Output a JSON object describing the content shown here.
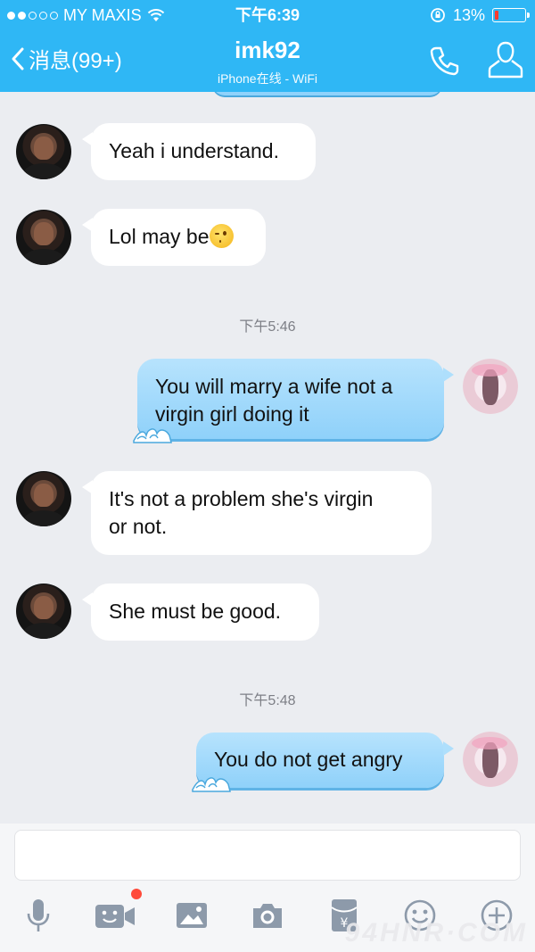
{
  "status": {
    "carrier": "MY MAXIS",
    "time": "下午6:39",
    "battery": "13%",
    "battery_level": 0.13,
    "signal_bars_filled": 2,
    "signal_bars_total": 5
  },
  "nav": {
    "back_label": "消息(99+)",
    "title": "imk92",
    "subtitle": "iPhone在线 - WiFi"
  },
  "messages": [
    {
      "type": "in",
      "text": "Yeah i understand."
    },
    {
      "type": "in",
      "text": "Lol may be"
    },
    {
      "type": "time",
      "text": "下午5:46"
    },
    {
      "type": "out",
      "line1": "You will marry a wife not a",
      "line2": "virgin girl doing it"
    },
    {
      "type": "in",
      "line1": "It's not a problem she's virgin",
      "line2": "or not."
    },
    {
      "type": "in",
      "text": "She must be good."
    },
    {
      "type": "time",
      "text": "下午5:48"
    },
    {
      "type": "out",
      "text": "You do not get angry"
    }
  ],
  "composer": {
    "value": ""
  },
  "toolbar": {
    "items": [
      "microphone-icon",
      "video-icon",
      "image-icon",
      "camera-icon",
      "red-packet-icon",
      "emoji-icon",
      "plus-icon"
    ]
  },
  "watermark": "94HNR·COM",
  "colors": {
    "header": "#2fb7f5",
    "background": "#ebedf1",
    "incoming_bubble": "#ffffff",
    "outgoing_bubble": "#a7dcfc",
    "notification_dot": "#ff4a3a"
  }
}
